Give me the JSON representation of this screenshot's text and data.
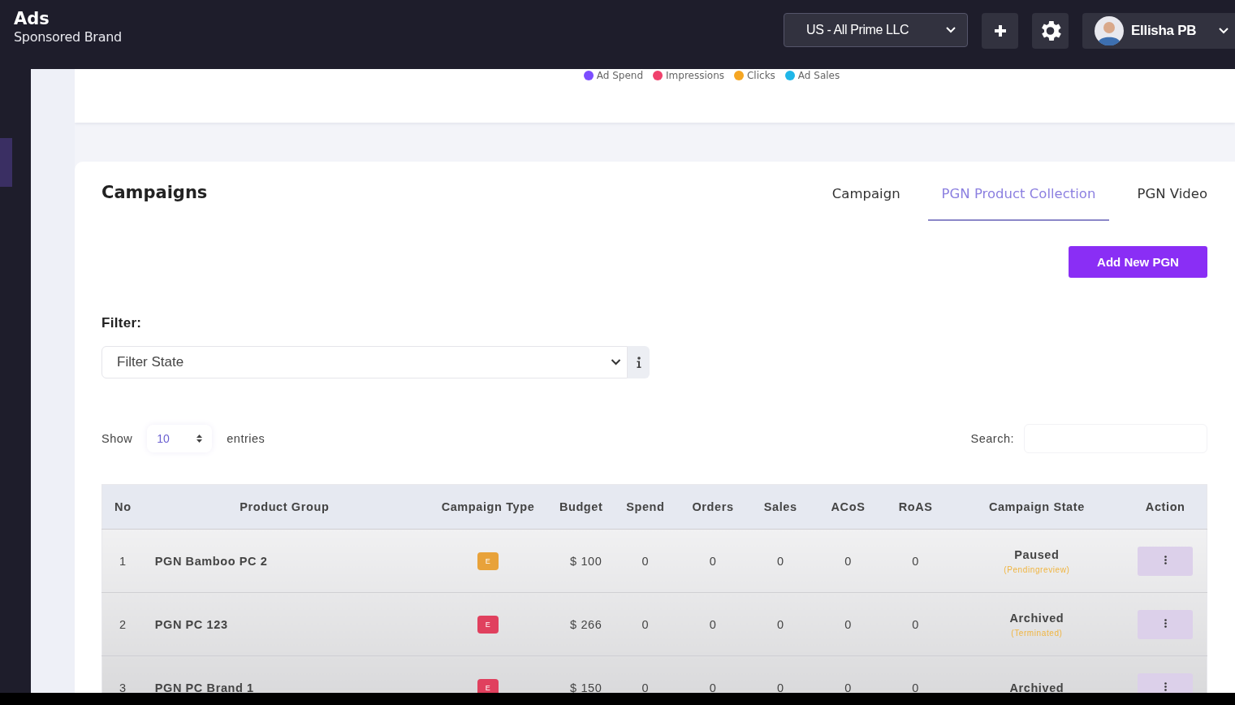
{
  "header": {
    "title": "Ads",
    "subtitle": "Sponsored Brand",
    "account": "US - All Prime LLC",
    "user": "Ellisha PB"
  },
  "chart_legend": [
    {
      "label": "Ad Spend",
      "color": "#7c4dff"
    },
    {
      "label": "Impressions",
      "color": "#f0416c"
    },
    {
      "label": "Clicks",
      "color": "#f5a623"
    },
    {
      "label": "Ad Sales",
      "color": "#1fb6e8"
    }
  ],
  "campaigns": {
    "title": "Campaigns",
    "tabs": [
      {
        "label": "Campaign",
        "selected": false
      },
      {
        "label": "PGN Product Collection",
        "selected": true
      },
      {
        "label": "PGN Video",
        "selected": false
      }
    ],
    "add_button": "Add New PGN",
    "filter_label": "Filter:",
    "filter_select": {
      "placeholder": "Filter State"
    },
    "show_label": "Show",
    "page_size": "10",
    "entries_label": "entries",
    "search_label": "Search:",
    "table": {
      "columns": [
        "No",
        "Product Group",
        "Campaign Type",
        "Budget",
        "Spend",
        "Orders",
        "Sales",
        "ACoS",
        "RoAS",
        "Campaign State",
        "Action"
      ],
      "rows": [
        {
          "no": "1",
          "product_group": "PGN Bamboo PC 2",
          "type_badge": {
            "label": "E",
            "color": "#e8a23a"
          },
          "budget": "$ 100",
          "spend": "0",
          "orders": "0",
          "sales": "0",
          "acos": "0",
          "roas": "0",
          "state": "Paused",
          "sub_state": "(Pendingreview)"
        },
        {
          "no": "2",
          "product_group": "PGN PC 123",
          "type_badge": {
            "label": "E",
            "color": "#e0405e"
          },
          "budget": "$ 266",
          "spend": "0",
          "orders": "0",
          "sales": "0",
          "acos": "0",
          "roas": "0",
          "state": "Archived",
          "sub_state": "(Terminated)"
        },
        {
          "no": "3",
          "product_group": "PGN PC Brand 1",
          "type_badge": {
            "label": "E",
            "color": "#e0405e"
          },
          "budget": "$ 150",
          "spend": "0",
          "orders": "0",
          "sales": "0",
          "acos": "0",
          "roas": "0",
          "state": "Archived"
        }
      ]
    }
  }
}
